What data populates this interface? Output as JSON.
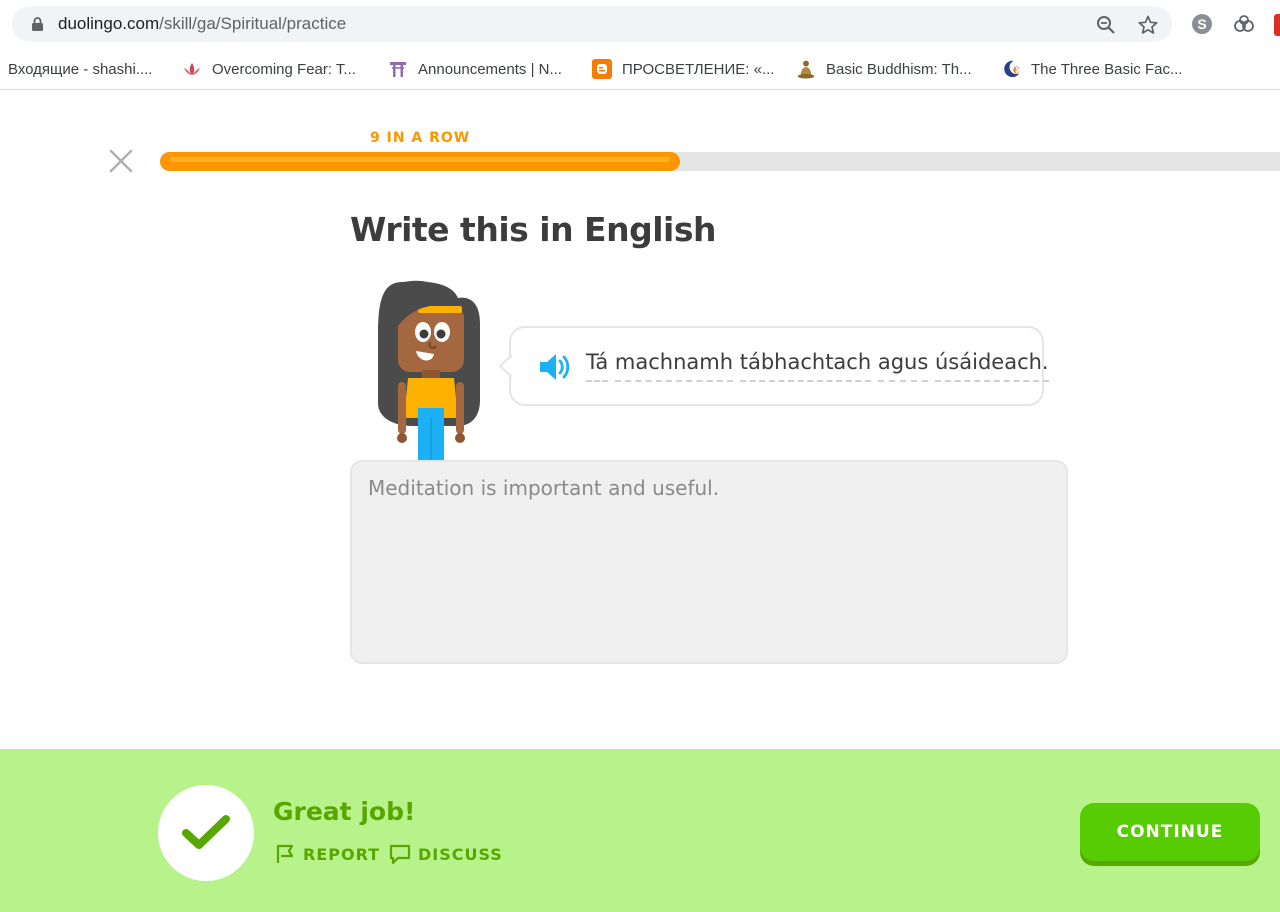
{
  "browser": {
    "url_host": "duolingo.com",
    "url_path": "/skill/ga/Spiritual/practice",
    "icons": [
      "lock-icon",
      "zoom-icon",
      "star-icon",
      "skype-icon",
      "extension-icon"
    ]
  },
  "bookmarks": [
    {
      "label": "Входящие - shashi....",
      "icon": "none"
    },
    {
      "label": "Overcoming Fear: T...",
      "icon": "lotus-icon"
    },
    {
      "label": "Announcements | N...",
      "icon": "torii-icon"
    },
    {
      "label": "ПРОСВЕТЛЕНИЕ: «...",
      "icon": "blogger-icon"
    },
    {
      "label": "Basic Buddhism: Th...",
      "icon": "buddha-icon"
    },
    {
      "label": "The Three Basic Fac...",
      "icon": "moon-icon"
    }
  ],
  "lesson": {
    "streak": "9 IN A ROW",
    "progress": 0.46,
    "title": "Write this in English",
    "sentence_words": [
      "Tá",
      "machnamh",
      "tábhachtach",
      "agus",
      "úsáideach."
    ],
    "answer": "Meditation is important and useful."
  },
  "feedback": {
    "message": "Great job!",
    "report_label": "REPORT",
    "discuss_label": "DISCUSS",
    "continue_label": "CONTINUE"
  },
  "colors": {
    "progress": "#ff9600",
    "success_bg": "#b8f28b",
    "success_text": "#58a700",
    "button": "#58cc02",
    "speaker": "#1cb0f6"
  }
}
